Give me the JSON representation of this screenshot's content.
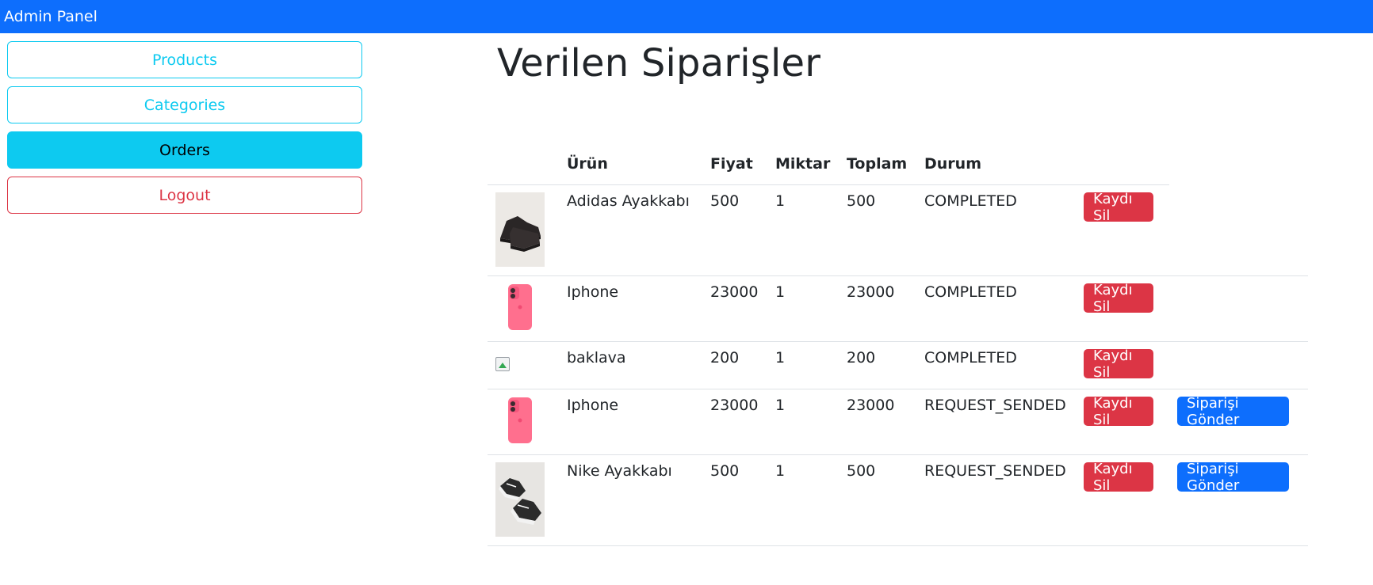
{
  "header": {
    "brand": "Admin Panel"
  },
  "sidebar": {
    "items": [
      {
        "label": "Products"
      },
      {
        "label": "Categories"
      },
      {
        "label": "Orders"
      },
      {
        "label": "Logout"
      }
    ]
  },
  "main": {
    "title": "Verilen Siparişler",
    "columns": {
      "product": "Ürün",
      "price": "Fiyat",
      "quantity": "Miktar",
      "total": "Toplam",
      "status": "Durum"
    },
    "delete_label": "Kaydı Sil",
    "send_label": "Siparişi Gönder",
    "orders": [
      {
        "name": "Adidas Ayakkabı",
        "price": "500",
        "qty": "1",
        "total": "500",
        "status": "COMPLETED",
        "image": "black-sneaker"
      },
      {
        "name": "Iphone",
        "price": "23000",
        "qty": "1",
        "total": "23000",
        "status": "COMPLETED",
        "image": "pink-phone"
      },
      {
        "name": "baklava",
        "price": "200",
        "qty": "1",
        "total": "200",
        "status": "COMPLETED",
        "image": "broken-image"
      },
      {
        "name": "Iphone",
        "price": "23000",
        "qty": "1",
        "total": "23000",
        "status": "REQUEST_SENDED",
        "image": "pink-phone"
      },
      {
        "name": "Nike Ayakkabı",
        "price": "500",
        "qty": "1",
        "total": "500",
        "status": "REQUEST_SENDED",
        "image": "converse-sneakers"
      }
    ]
  },
  "colors": {
    "primary": "#0d6efd",
    "info": "#0dcaf0",
    "danger": "#dc3545"
  }
}
